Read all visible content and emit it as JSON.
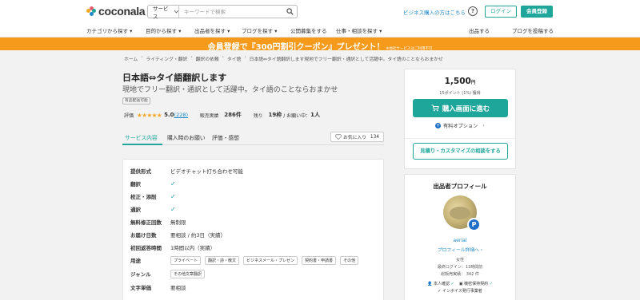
{
  "header": {
    "logo_text": "coconala",
    "search_category": "サービス",
    "search_placeholder": "キーワードで検索",
    "business_link": "ビジネス購入の方はこちら",
    "help_label": "?",
    "login_label": "ログイン",
    "signup_label": "会員登録"
  },
  "nav": {
    "items": [
      "カテゴリから探す",
      "目的から探す",
      "出品者を探す",
      "ブログを探す",
      "公開募集をする",
      "仕事・相談を探す",
      "出品する",
      "ブログを投稿する"
    ]
  },
  "banner": {
    "text": "会員登録で『300円割引クーポン』プレゼント！",
    "note": "※他社サービスはご利用不可"
  },
  "breadcrumb": [
    "ホーム",
    "ライティング・翻訳",
    "翻訳の依頼",
    "タイ語",
    "日本語⇔タイ語翻訳します現地でフリー翻訳・通訳として活躍中。タイ語のことならおまかせ"
  ],
  "service": {
    "title": "日本語⇔タイ語翻訳します",
    "subtitle": "現地でフリー翻訳・通訳として活躍中。タイ語のことならおまかせ",
    "tag": "有品配送可能",
    "rating_label": "評価",
    "stars": "★★★★★",
    "rating": "5.0",
    "review_count": "(228)",
    "sales_label": "販売実績",
    "sales_value": "286件",
    "remaining_label": "残り",
    "remaining_value": "19枠",
    "inquiry_label": "/ お願い中：",
    "inquiry_value": "1人"
  },
  "tabs": [
    "サービス内容",
    "購入時のお願い",
    "評価・感想"
  ],
  "favorite": {
    "label": "お気に入り",
    "count": "134"
  },
  "details": [
    {
      "label": "提供形式",
      "value": "ビデオチャット打ち合わせ可能"
    },
    {
      "label": "翻訳",
      "check": "✓"
    },
    {
      "label": "校正・添削",
      "check": "✓"
    },
    {
      "label": "通訳",
      "check": "✓"
    },
    {
      "label": "無料修正回数",
      "value": "無制限"
    },
    {
      "label": "お届け日数",
      "value": "要相談 / 約3日（実績）"
    },
    {
      "label": "初回返答時間",
      "value": "1時間以内（実績）"
    },
    {
      "label": "用途",
      "chips": [
        "プライベート",
        "翻訳・詩・散文",
        "ビジネスメール・プレゼン",
        "契約書・申請書",
        "その他"
      ]
    },
    {
      "label": "ジャンル",
      "chips": [
        "その他文章翻訳"
      ]
    },
    {
      "label": "文字単価",
      "value": "要相談"
    }
  ],
  "purchase": {
    "price": "1,500",
    "price_unit": "円",
    "points": "15ポイント (1%) 獲得",
    "buy_label": "購入画面に進む",
    "paid_option": "有料オプション",
    "quote_label": "見積り・カスタマイズの相談をする"
  },
  "profile": {
    "title": "出品者プロフィール",
    "badge": "P",
    "username": "aerial",
    "profile_link": "プロフィール詳細へ",
    "gender": "女性",
    "last_login": "最終ログイン：11時間前",
    "sales": "総販売実績： 342 件",
    "verif1": "本人確認",
    "verif2": "機密保持契約",
    "verif3": "インボイス発行事業者"
  },
  "colors": {
    "accent": "#1ea69a",
    "banner": "#f59a1b",
    "link": "#1e88c8",
    "star": "#f5a623"
  }
}
